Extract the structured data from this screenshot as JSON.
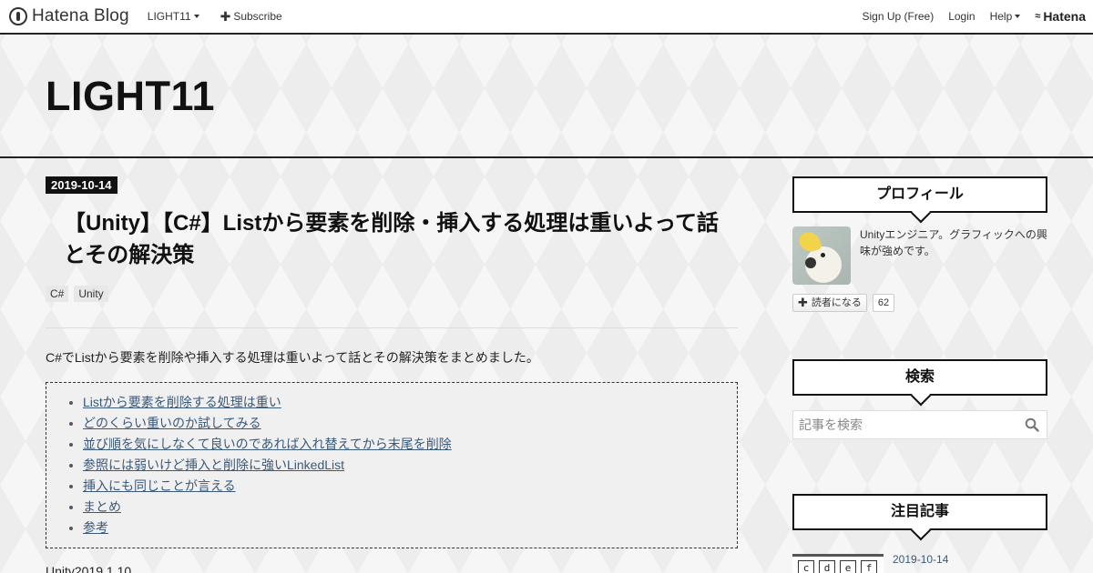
{
  "globalbar": {
    "brand": "Hatena Blog",
    "blog_menu": "LIGHT11",
    "subscribe": "Subscribe",
    "signup": "Sign Up (Free)",
    "login": "Login",
    "help": "Help",
    "hatena": "Hatena"
  },
  "header": {
    "blog_title": "LIGHT11"
  },
  "entry": {
    "date": "2019-10-14",
    "title": "【Unity】【C#】Listから要素を削除・挿入する処理は重いよって話とその解決策",
    "categories": [
      "C#",
      "Unity"
    ],
    "lead": "C#でListから要素を削除や挿入する処理は重いよって話とその解決策をまとめました。",
    "toc": [
      "Listから要素を削除する処理は重い",
      "どのくらい重いのか試してみる",
      "並び順を気にしなくて良いのであれば入れ替えてから末尾を削除",
      "参照には弱いけど挿入と削除に強いLinkedList",
      "挿入にも同じことが言える",
      "まとめ",
      "参考"
    ],
    "version": "Unity2019.1.10"
  },
  "sidebar": {
    "profile": {
      "title": "プロフィール",
      "description": "Unityエンジニア。グラフィックへの興味が強めです。",
      "reader_button": "読者になる",
      "reader_count": "62"
    },
    "search": {
      "title": "検索",
      "placeholder": "記事を検索"
    },
    "popular": {
      "title": "注目記事",
      "items": [
        {
          "date": "2019-10-14",
          "thumb_letters": [
            "c",
            "d",
            "e",
            "f"
          ]
        }
      ]
    }
  }
}
